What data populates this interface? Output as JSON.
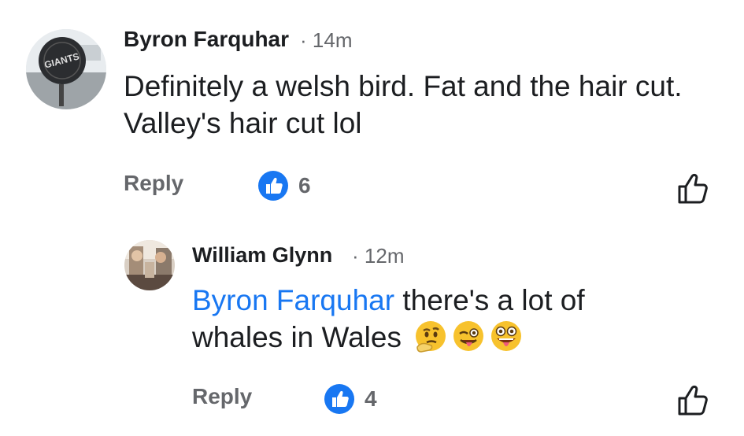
{
  "comments": [
    {
      "author": "Byron Farquhar",
      "separator": "·",
      "time": "14m",
      "text": "Definitely a welsh bird. Fat and the hair cut. Valley's hair cut lol",
      "reply_label": "Reply",
      "reaction_count": "6",
      "avatar_badge_text": "GIANTS"
    },
    {
      "author": "William Glynn",
      "separator": "·",
      "time": "12m",
      "mention": "Byron Farquhar",
      "text": " there's a lot of whales in Wales",
      "emojis": [
        "thinking-face",
        "winking-face-with-tongue",
        "zany-face"
      ],
      "reply_label": "Reply",
      "reaction_count": "4"
    }
  ],
  "colors": {
    "brand_blue": "#1877f2",
    "secondary_text": "#65676b",
    "primary_text": "#1c1e21"
  }
}
